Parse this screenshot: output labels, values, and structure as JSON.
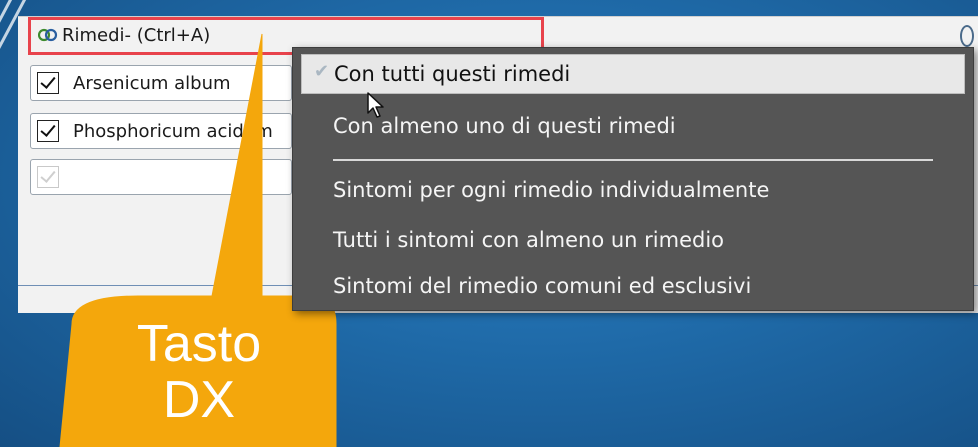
{
  "panel": {
    "title": "Rimedi- (Ctrl+A)",
    "rows": [
      {
        "label": "Arsenicum album",
        "checked": true
      },
      {
        "label": "Phosphoricum acidum",
        "checked": true
      },
      {
        "label": "",
        "checked": true,
        "disabled": true
      }
    ]
  },
  "context_menu": {
    "items": [
      {
        "label": "Con tutti questi rimedi",
        "checked": true,
        "highlighted": true
      },
      {
        "label": "Con almeno uno di questi rimedi"
      },
      {
        "label": "Sintomi per ogni rimedio individualmente"
      },
      {
        "label": "Tutti i sintomi con almeno un rimedio"
      },
      {
        "label": "Sintomi del rimedio comuni ed esclusivi"
      }
    ]
  },
  "callout": {
    "line1": "Tasto",
    "line2": "DX",
    "color": "#f4a70c"
  },
  "colors": {
    "highlight_box": "#e8434c",
    "menu_bg": "#555555",
    "background": "#1f6aa8"
  },
  "icons": {
    "title_icon": "remedies-rings-icon",
    "menu_check": "checkmark-icon",
    "pointer": "mouse-cursor-icon"
  }
}
